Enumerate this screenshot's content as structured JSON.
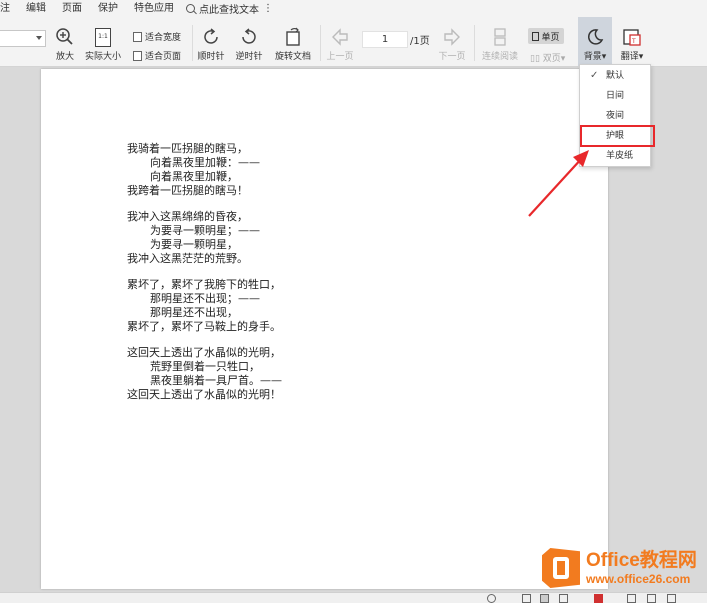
{
  "menu": {
    "items": [
      "注",
      "编辑",
      "页面",
      "保护",
      "特色应用"
    ],
    "search_placeholder": "点此查找文本"
  },
  "toolbar": {
    "zoom_in_label": "放大",
    "actual_size_label": "实际大小",
    "fit_width_label": "适合宽度",
    "fit_page_label": "适合页面",
    "rotate_cw_label": "顺时针",
    "rotate_ccw_label": "逆时针",
    "rotate_doc_label": "旋转文档",
    "prev_page_label": "上一页",
    "current_page": "1",
    "total_pages": "/1页",
    "next_page_label": "下一页",
    "continuous_label": "连续阅读",
    "single_page_label": "单页",
    "double_page_label": "双页",
    "background_label": "背景",
    "translate_label": "翻译",
    "actual_size_glyph": "1:1"
  },
  "background_menu": {
    "items": [
      "默认",
      "日间",
      "夜间",
      "护眼",
      "羊皮纸"
    ],
    "checked": "默认",
    "highlighted": "护眼"
  },
  "document": {
    "stanzas": [
      [
        {
          "text": "我骑着一匹拐腿的瞎马，",
          "indent": false
        },
        {
          "text": "向着黑夜里加鞭：——",
          "indent": true
        },
        {
          "text": "向着黑夜里加鞭，",
          "indent": true
        },
        {
          "text": "我跨着一匹拐腿的瞎马！",
          "indent": false
        }
      ],
      [
        {
          "text": "我冲入这黑绵绵的昏夜，",
          "indent": false
        },
        {
          "text": "为要寻一颗明星；——",
          "indent": true
        },
        {
          "text": "为要寻一颗明星，",
          "indent": true
        },
        {
          "text": "我冲入这黑茫茫的荒野。",
          "indent": false
        }
      ],
      [
        {
          "text": "累坏了，累坏了我胯下的牲口，",
          "indent": false
        },
        {
          "text": "那明星还不出现；——",
          "indent": true
        },
        {
          "text": "那明星还不出现，",
          "indent": true
        },
        {
          "text": "累坏了，累坏了马鞍上的身手。",
          "indent": false
        }
      ],
      [
        {
          "text": "这回天上透出了水晶似的光明，",
          "indent": false
        },
        {
          "text": "荒野里倒着一只牲口，",
          "indent": true
        },
        {
          "text": "黑夜里躺着一具尸首。——",
          "indent": true
        },
        {
          "text": "这回天上透出了水晶似的光明！",
          "indent": false
        }
      ]
    ]
  },
  "watermark": {
    "title": "Office教程网",
    "url": "www.office26.com"
  },
  "colors": {
    "highlight_red": "#e8282b",
    "watermark_orange": "#f27b1f",
    "bg_button_active": "#cfd5dd"
  }
}
